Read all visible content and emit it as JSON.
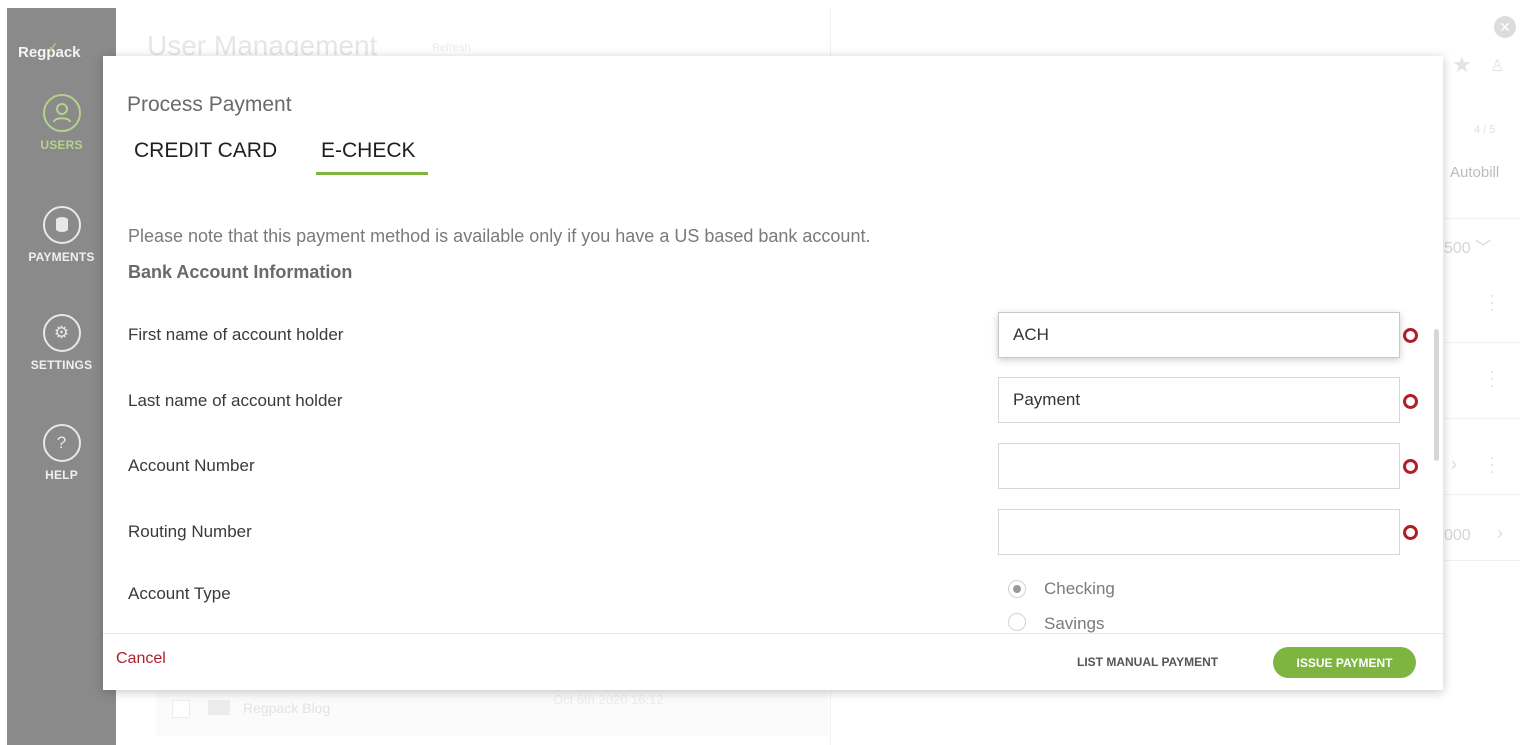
{
  "sidebar": {
    "logo": "Regpack",
    "items": [
      {
        "label": "USERS",
        "icon": "user-icon",
        "active": true
      },
      {
        "label": "PAYMENTS",
        "icon": "coins-icon",
        "active": false
      },
      {
        "label": "SETTINGS",
        "icon": "gear-icon",
        "active": false
      },
      {
        "label": "HELP",
        "icon": "help-icon",
        "active": false
      }
    ]
  },
  "background": {
    "title": "User Management",
    "refresh": "Refresh",
    "pager": "4 / 5",
    "autobill": "Autobill",
    "amount_1": "500",
    "amount_2": "000",
    "row_name": "Regpack Blog",
    "row_date": "Oct 6th 2020 16:12"
  },
  "modal": {
    "title": "Process Payment",
    "tabs": [
      {
        "label": "CREDIT CARD",
        "active": false
      },
      {
        "label": "E-CHECK",
        "active": true
      }
    ],
    "note": "Please note that this payment method is available only if you have a US based bank account.",
    "section_title": "Bank Account Information",
    "fields": [
      {
        "label": "First name of account holder",
        "value": "ACH",
        "required": true
      },
      {
        "label": "Last name of account holder",
        "value": "Payment",
        "required": true
      },
      {
        "label": "Account Number",
        "value": "",
        "required": true
      },
      {
        "label": "Routing Number",
        "value": "",
        "required": true
      }
    ],
    "account_type": {
      "label": "Account Type",
      "options": [
        {
          "label": "Checking",
          "selected": true
        },
        {
          "label": "Savings",
          "selected": false
        }
      ]
    },
    "footer": {
      "cancel": "Cancel",
      "list_manual": "LIST MANUAL PAYMENT",
      "issue": "ISSUE PAYMENT"
    }
  },
  "colors": {
    "sidebar_bg": "#8a8a8a",
    "accent_green": "#7db540",
    "required_red": "#b01e2a"
  }
}
